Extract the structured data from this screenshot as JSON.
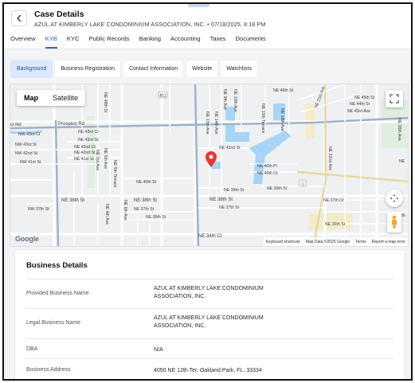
{
  "header": {
    "back_icon": "chevron-left-icon",
    "title": "Case Details",
    "subtitle": "AZUL AT KIMBERLY LAKE CONDOMINIUM ASSOCIATION, INC. • 07/18/2025, 8:18 PM"
  },
  "tabs": [
    {
      "label": "Overview",
      "active": false
    },
    {
      "label": "KYB",
      "active": true
    },
    {
      "label": "KYC",
      "active": false
    },
    {
      "label": "Public Records",
      "active": false
    },
    {
      "label": "Banking",
      "active": false
    },
    {
      "label": "Accounting",
      "active": false
    },
    {
      "label": "Taxes",
      "active": false
    },
    {
      "label": "Documents",
      "active": false
    }
  ],
  "subtabs": [
    {
      "label": "Background",
      "active": true
    },
    {
      "label": "Business Registration",
      "active": false
    },
    {
      "label": "Contact Information",
      "active": false
    },
    {
      "label": "Website",
      "active": false
    },
    {
      "label": "Watchlists",
      "active": false
    }
  ],
  "map": {
    "type_map": "Map",
    "type_satellite": "Satellite",
    "google_logo": "Google",
    "attribution": {
      "shortcuts": "Keyboard shortcuts",
      "data": "Map Data ©2025 Google",
      "terms": "Terms",
      "report": "Report a map error"
    },
    "streets": {
      "prospect_rd": "Prospect Rd",
      "rd_left": "ct Rd",
      "nw43rd_ct": "NW 43rd Ct",
      "nw43rd_st": "NW 43rd St",
      "nw43rd_st_left": "NW 42nd St",
      "nw41st": "NW 41st St",
      "ne43rd_ct": "NE 43rd Ct",
      "ne43rd_st": "NE 43rd St",
      "ne42nd_ct": "NE 42nd Ct",
      "ne42nd_st_l": "NE 42nd St",
      "ne41st_st": "NE 41st St",
      "ne42nd_st": "NE 42nd St",
      "ne40th_st": "NE 40th St",
      "ne39th_st": "NE 39th St",
      "ne39th_st_r": "NE 39th St",
      "ne38th_st_l": "NE 38th St",
      "ne38th_st_m": "NE 38th St",
      "ne38th_st_r": "NE 38th St",
      "ne37th_st_l": "NW 37th St",
      "ne37th_st_m": "NE 37th St",
      "ne37th_st_r": "NE 37th St",
      "ne36th_st": "NE 36th St",
      "ne36th_st_r": "NE 36th St",
      "ne34th_ct": "NE 34th Ct",
      "ne40th_pl": "NE 40th Pl",
      "ne40th_ct": "NE 40th Ct",
      "ne37th_dr": "NE 37th Dr",
      "ne37th_st_far": "NE 37th",
      "ne46th_st": "NE 46th St",
      "ne45th_st": "NE 45th St",
      "ne44th_st": "NE 44th St",
      "ne43rd_ave": "NE 43rd Ave",
      "ne13th_ave": "NE 13th Ave",
      "ne14th_ave": "NE 14th Ave",
      "ne15th_terrace": "NE 15th Terrace",
      "ne18th_ave": "NE 18th Ave",
      "ne21st_ave": "NE 21st Ave",
      "ne22nd_ave": "NE 22nd Ave",
      "ne26th_ave": "NE 26th Ave",
      "ne5th_ave": "NE 5th Ave",
      "ne5th_terrace": "NE 5th Terrace",
      "ne6th_ave": "NE 6th Ave",
      "ne4th_ave": "NE 4th Ave",
      "ne3rd_ave": "NE 3rd Ave",
      "ne9th_ave": "NE 9th Ave",
      "ne10th_ave": "NE 10th Ave",
      "ne48th": "NE 48th St",
      "route_811": "811",
      "route_1": "1",
      "ne_right": "NE"
    }
  },
  "business_details": {
    "title": "Business Details",
    "rows": [
      {
        "label": "Provided Business Name",
        "value": "AZUL AT KIMBERLY LAKE CONDOMINIUM ASSOCIATION, INC."
      },
      {
        "label": "Legal Business Name",
        "value": "AZUL AT KIMBERLY LAKE CONDOMINIUM ASSOCIATION, INC."
      },
      {
        "label": "DBA",
        "value": "N/A"
      },
      {
        "label": "Business Address",
        "value": "4050 NE 12th Ter, Oakland Park, FL, 33334"
      }
    ]
  },
  "colors": {
    "accent": "#2a63c7",
    "pin": "#e53935",
    "water": "#a8d4f5",
    "park": "#dfeede"
  }
}
